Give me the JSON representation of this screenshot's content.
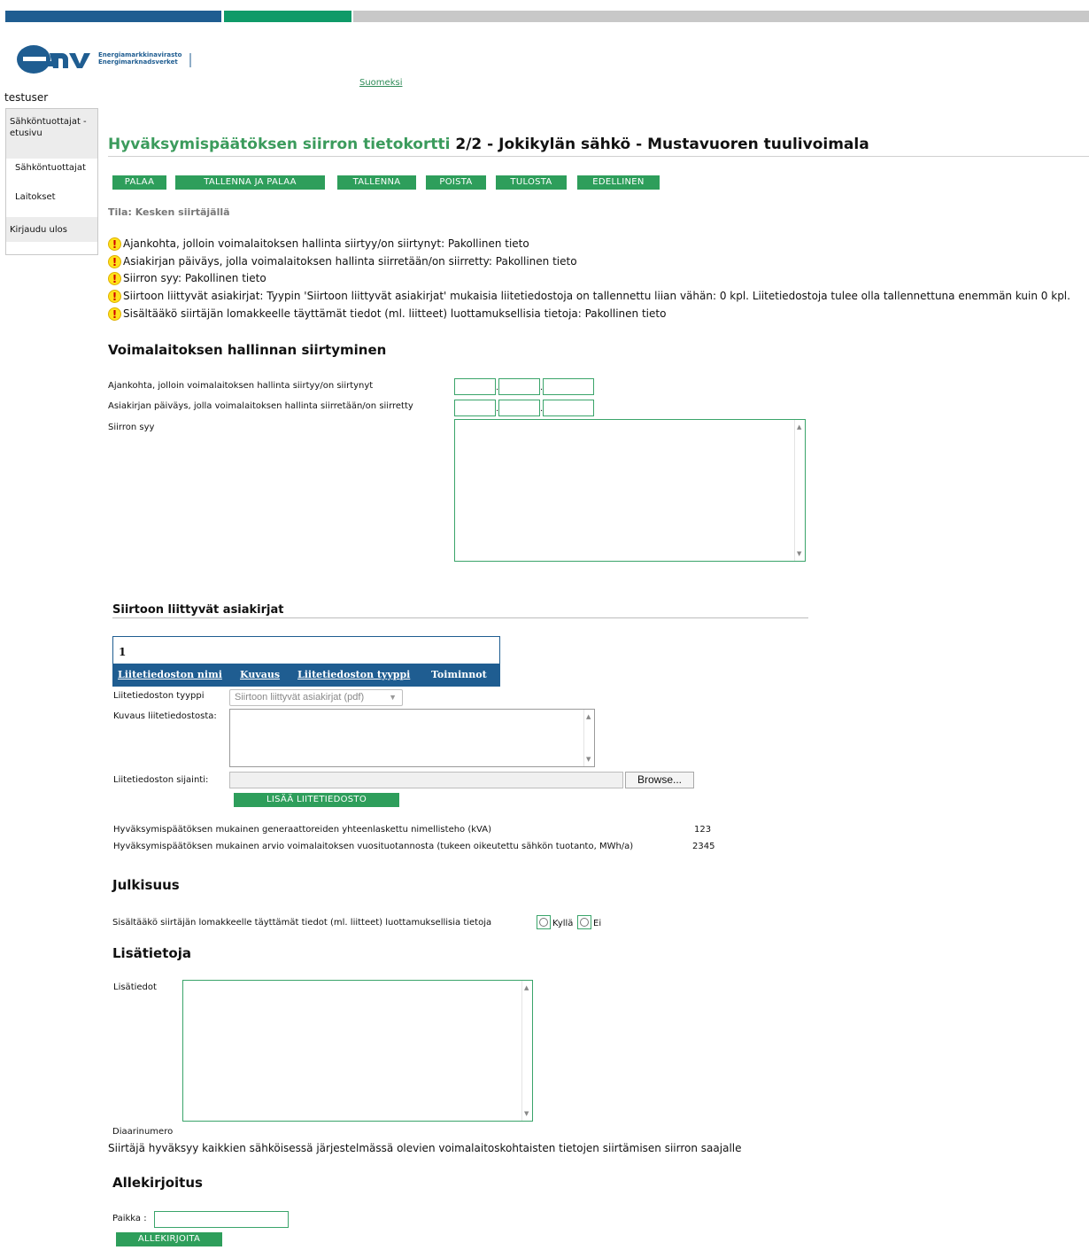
{
  "brand": {
    "logo_text": "emv",
    "org_fi": "Energiamarkkinavirasto",
    "org_sv": "Energimarknadsverket",
    "colors": {
      "blue": "#1f5d91",
      "green": "#0f9a68",
      "button_green": "#2e9e5b",
      "title_green": "#3b9b5c"
    }
  },
  "header": {
    "language_link": "Suomeksi",
    "username": "testuser"
  },
  "sidebar": {
    "items": [
      {
        "label": "Sähköntuottajat - etusivu"
      },
      {
        "label": "Sähköntuottajat"
      },
      {
        "label": "Laitokset"
      },
      {
        "label": "Kirjaudu ulos"
      }
    ]
  },
  "page": {
    "title_prefix": "Hyväksymispäätöksen siirron tietokortti",
    "title_rest": "2/2 - Jokikylän sähkö - Mustavuoren tuulivoimala",
    "status": "Tila: Kesken siirtäjällä"
  },
  "toolbar": {
    "buttons": [
      "PALAA",
      "TALLENNA JA PALAA",
      "TALLENNA",
      "POISTA",
      "TULOSTA",
      "EDELLINEN"
    ]
  },
  "warnings": {
    "icon": "warning-icon",
    "items": [
      "Ajankohta, jolloin voimalaitoksen hallinta siirtyy/on siirtynyt: Pakollinen tieto",
      "Asiakirjan päiväys, jolla voimalaitoksen hallinta siirretään/on siirretty: Pakollinen tieto",
      "Siirron syy: Pakollinen tieto",
      "Siirtoon liittyvät asiakirjat: Tyypin 'Siirtoon liittyvät asiakirjat' mukaisia liitetiedostoja on tallennettu liian vähän: 0 kpl. Liitetiedostoja tulee olla tallennettuna enemmän kuin 0 kpl.",
      "Sisältääkö siirtäjän lomakkeelle täyttämät tiedot (ml. liitteet) luottamuksellisia tietoja: Pakollinen tieto"
    ]
  },
  "transfer_section": {
    "heading": "Voimalaitoksen hallinnan siirtyminen",
    "date1_label": "Ajankohta, jolloin voimalaitoksen hallinta siirtyy/on siirtynyt",
    "date2_label": "Asiakirjan päiväys, jolla voimalaitoksen hallinta siirretään/on siirretty",
    "date_separator": ".",
    "reason_label": "Siirron syy"
  },
  "documents": {
    "heading": "Siirtoon liittyvät asiakirjat",
    "table_number": "1",
    "columns": [
      "Liitetiedoston nimi",
      "Kuvaus",
      "Liitetiedoston tyyppi",
      "Toiminnot"
    ],
    "file_type_label": "Liitetiedoston tyyppi",
    "file_type_value": "Siirtoon liittyvät asiakirjat (pdf)",
    "description_label": "Kuvaus liitetiedostosta:",
    "location_label": "Liitetiedoston sijainti:",
    "browse_label": "Browse...",
    "add_button": "LISÄÄ LIITETIEDOSTO"
  },
  "capacity": {
    "power_label": "Hyväksymispäätöksen mukainen generaattoreiden yhteenlaskettu nimellisteho (kVA)",
    "power_value": "123",
    "production_label": "Hyväksymispäätöksen mukainen arvio voimalaitoksen vuosituotannosta (tukeen oikeutettu sähkön tuotanto, MWh/a)",
    "production_value": "2345"
  },
  "publicity": {
    "heading": "Julkisuus",
    "question": "Sisältääkö siirtäjän lomakkeelle täyttämät tiedot (ml. liitteet) luottamuksellisia tietoja",
    "yes": "Kyllä",
    "no": "Ei"
  },
  "extra": {
    "heading": "Lisätietoja",
    "label": "Lisätiedot",
    "diary_label": "Diaarinumero",
    "consent": "Siirtäjä hyväksyy kaikkien sähköisessä järjestelmässä olevien voimalaitoskohtaisten tietojen siirtämisen siirron saajalle"
  },
  "signature": {
    "heading": "Allekirjoitus",
    "place_label": "Paikka :",
    "sign_button": "ALLEKIRJOITA"
  }
}
